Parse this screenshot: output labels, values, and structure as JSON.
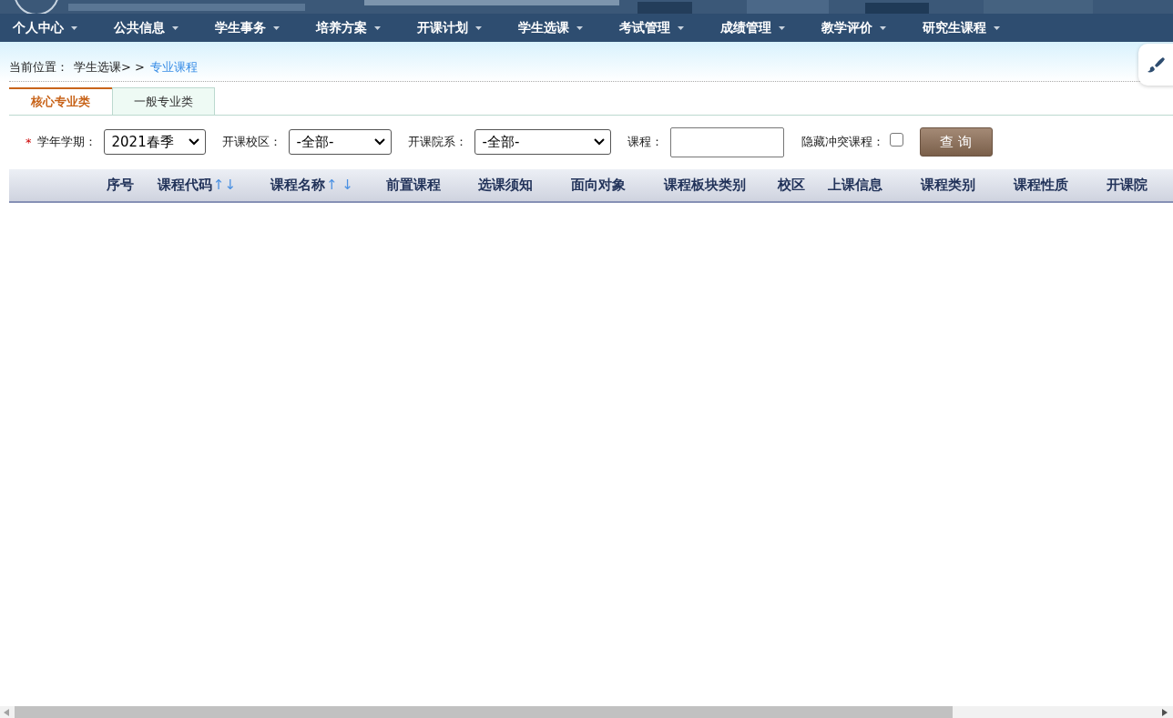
{
  "nav": [
    {
      "label": "个人中心"
    },
    {
      "label": "公共信息"
    },
    {
      "label": "学生事务"
    },
    {
      "label": "培养方案"
    },
    {
      "label": "开课计划"
    },
    {
      "label": "学生选课"
    },
    {
      "label": "考试管理"
    },
    {
      "label": "成绩管理"
    },
    {
      "label": "教学评价"
    },
    {
      "label": "研究生课程"
    }
  ],
  "breadcrumb": {
    "label": "当前位置：",
    "parent": "学生选课> >",
    "current": "专业课程"
  },
  "tabs": [
    {
      "label": "核心专业类",
      "selected": true
    },
    {
      "label": "一般专业类",
      "selected": false
    }
  ],
  "filters": {
    "required_mark": "*",
    "term_label": "学年学期：",
    "term_value": "2021春季",
    "campus_label": "开课校区：",
    "campus_value": "-全部-",
    "dept_label": "开课院系：",
    "dept_value": "-全部-",
    "course_label": "课程：",
    "hide_conflict_label": "隐藏冲突课程：",
    "hide_conflict_checked": false,
    "search_button": "查 询"
  },
  "table": {
    "columns": [
      {
        "label": "序号"
      },
      {
        "label": "课程代码",
        "sort_arrows": "↑↓"
      },
      {
        "label": "课程名称",
        "sort_arrows": "↑ ↓"
      },
      {
        "label": "前置课程"
      },
      {
        "label": "选课须知"
      },
      {
        "label": "面向对象"
      },
      {
        "label": "课程板块类别"
      },
      {
        "label": "校区"
      },
      {
        "label": "上课信息"
      },
      {
        "label": "课程类别"
      },
      {
        "label": "课程性质"
      },
      {
        "label": "开课院"
      }
    ]
  }
}
